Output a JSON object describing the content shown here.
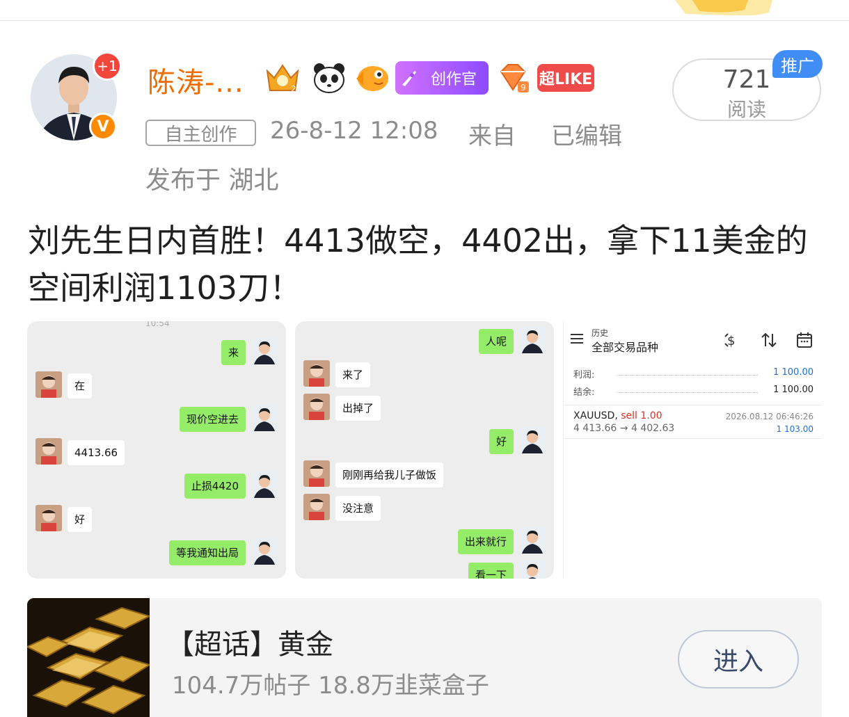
{
  "post": {
    "author": {
      "name": "陈涛-...",
      "plus_badge": "+1",
      "verified_badge": "V"
    },
    "medals": {
      "creator_label": "创作官",
      "like_label": "超LIKE"
    },
    "meta": {
      "original_tag": "自主创作",
      "time": "26-8-12 12:08",
      "from": "来自",
      "edited": "已编辑",
      "location": "发布于 湖北"
    },
    "read": {
      "count": "721",
      "label": "阅读",
      "promo": "推广"
    },
    "text": "刘先生日内首胜！4413做空，4402出，拿下11美金的空间利润1103刀！"
  },
  "chat1": {
    "timestamp": "10:54",
    "messages": [
      {
        "side": "right",
        "text": "来"
      },
      {
        "side": "left",
        "text": "在"
      },
      {
        "side": "right",
        "text": "现价空进去"
      },
      {
        "side": "left",
        "text": "4413.66"
      },
      {
        "side": "right",
        "text": "止损4420"
      },
      {
        "side": "left",
        "text": "好"
      },
      {
        "side": "right",
        "text": "等我通知出局"
      }
    ]
  },
  "chat2": {
    "messages": [
      {
        "side": "right",
        "text": "人呢"
      },
      {
        "side": "left",
        "text": "来了"
      },
      {
        "side": "left",
        "text": "出掉了"
      },
      {
        "side": "right",
        "text": "好"
      },
      {
        "side": "left",
        "text": "刚刚再给我儿子做饭"
      },
      {
        "side": "left",
        "text": "没注意"
      },
      {
        "side": "right",
        "text": "出来就行"
      },
      {
        "side": "right",
        "text": "看一下"
      }
    ]
  },
  "trade": {
    "header_small": "历史",
    "header_title": "全部交易品种",
    "profit_label": "利润:",
    "profit_value": "1 100.00",
    "balance_label": "结余:",
    "balance_value": "1 100.00",
    "symbol": "XAUUSD,",
    "side": "sell 1.00",
    "datetime": "2026.08.12 06:46:26",
    "prices": "4 413.66 → 4 402.63",
    "result": "1 103.00"
  },
  "topic": {
    "title": "【超话】黄金",
    "stats": "104.7万帖子 18.8万韭菜盒子",
    "enter": "进入"
  },
  "colors": {
    "username": "#ef6c00",
    "bubble_green": "#95ec69",
    "promo_blue": "#3f8df5",
    "profit_blue": "#1e6fd9",
    "sell_red": "#d93025"
  }
}
